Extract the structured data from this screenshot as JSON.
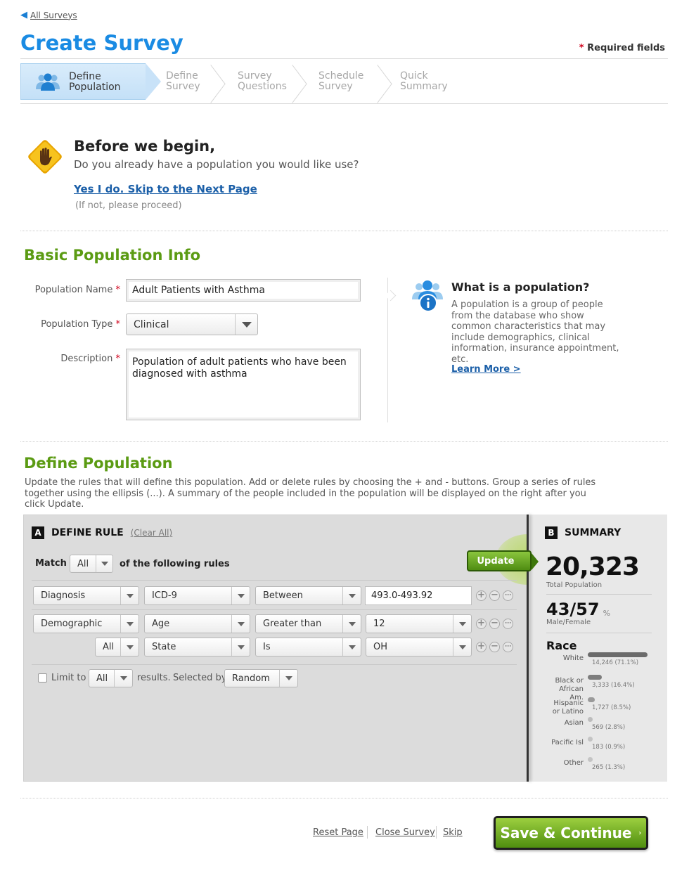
{
  "nav": {
    "back_label": "All Surveys"
  },
  "header": {
    "title": "Create Survey",
    "required_star": "*",
    "required_label": "Required fields"
  },
  "wizard": {
    "steps": [
      {
        "line1": "Define",
        "line2": "Population"
      },
      {
        "line1": "Define",
        "line2": "Survey"
      },
      {
        "line1": "Survey",
        "line2": "Questions"
      },
      {
        "line1": "Schedule",
        "line2": "Survey"
      },
      {
        "line1": "Quick",
        "line2": "Summary"
      }
    ]
  },
  "intro": {
    "title": "Before we begin,",
    "subtitle": "Do you already have a population you would like use?",
    "skip_link": "Yes I do. Skip to the Next Page",
    "note": "(If not, please proceed)"
  },
  "basic_info": {
    "title": "Basic Population Info",
    "name_label": "Population Name",
    "name_value": "Adult Patients with Asthma",
    "type_label": "Population Type",
    "type_value": "Clinical",
    "desc_label": "Description",
    "desc_value": "Population of adult patients who have been diagnosed with asthma",
    "required_star": "*"
  },
  "help": {
    "title": "What is a population?",
    "text": "A population is a group of people from the database who show common characteristics that may include demographics, clinical information, insurance appointment, etc.",
    "link": "Learn More >"
  },
  "define_population": {
    "title": "Define Population",
    "description": "Update the rules that will define this population.  Add or delete rules by choosing the + and - buttons.  Group a series of rules together using the ellipsis (...).  A summary of the people included in the population will be displayed on the right after you click Update."
  },
  "rules": {
    "badge": "A",
    "title": "DEFINE RULE",
    "clear_all": "(Clear All)",
    "match_label": "Match",
    "match_value": "All",
    "match_suffix": "of the following rules",
    "update_label": "Update",
    "row1": {
      "category": "Diagnosis",
      "field": "ICD-9",
      "operator": "Between",
      "value": "493.0-493.92"
    },
    "row2": {
      "category": "Demographic",
      "field": "Age",
      "operator": "Greater than",
      "value": "12"
    },
    "row3": {
      "category": "All",
      "field": "State",
      "operator": "Is",
      "value": "OH"
    },
    "plus": "+",
    "minus": "−",
    "ellipsis": "⋯",
    "limit_label": "Limit to",
    "limit_value": "All",
    "results_label": "results.",
    "selected_by_label": "Selected by",
    "selected_by_value": "Random"
  },
  "summary": {
    "badge": "B",
    "title": "SUMMARY",
    "total": "20,323",
    "total_label": "Total Population",
    "ratio": "43/57",
    "ratio_unit": "%",
    "ratio_label": "Male/Female",
    "race_title": "Race",
    "race": [
      {
        "label": "White",
        "value": "14,246 (71.1%)",
        "pct": 71.1,
        "color": "#6b6b6b"
      },
      {
        "label": "Black or African Am.",
        "value": "3,333 (16.4%)",
        "pct": 16.4,
        "color": "#7d7d7d"
      },
      {
        "label": "Hispanic or Latino",
        "value": "1,727 (8.5%)",
        "pct": 8.5,
        "color": "#9a9a9a"
      },
      {
        "label": "Asian",
        "value": "569 (2.8%)",
        "pct": 2.8,
        "color": "#bdbdbd"
      },
      {
        "label": "Pacific Isl",
        "value": "183 (0.9%)",
        "pct": 0.9,
        "color": "#c4c4c4"
      },
      {
        "label": "Other",
        "value": "265 (1.3%)",
        "pct": 1.3,
        "color": "#c4c4c4"
      }
    ]
  },
  "footer": {
    "reset": "Reset Page",
    "close": "Close Survey",
    "skip": "Skip",
    "save": "Save & Continue",
    "save_arrow": "›"
  }
}
